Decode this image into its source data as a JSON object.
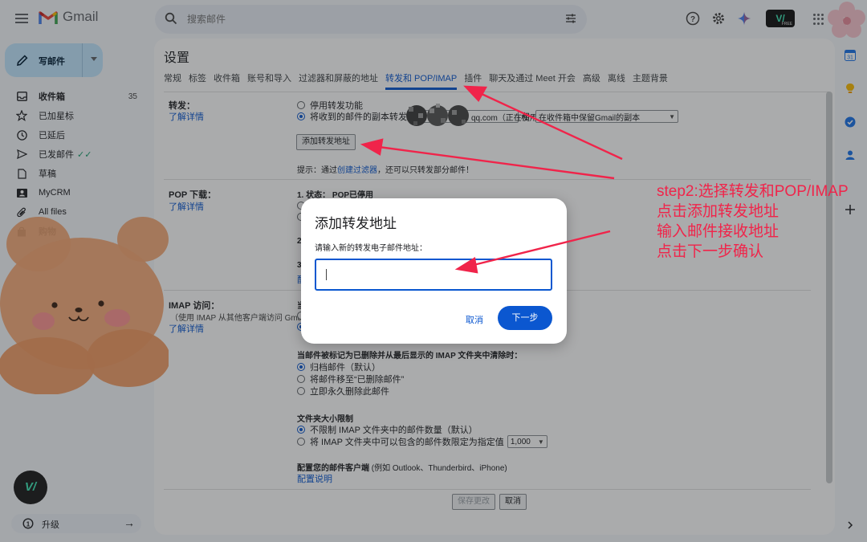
{
  "app": {
    "name": "Gmail"
  },
  "search": {
    "placeholder": "搜索邮件"
  },
  "header": {
    "brand_badge": "V/",
    "brand_badge_sub": "FREE"
  },
  "compose": {
    "label": "写邮件"
  },
  "nav": {
    "items": [
      {
        "label": "收件箱",
        "count": "35",
        "icon": "inbox-icon",
        "bold": true
      },
      {
        "label": "已加星标",
        "icon": "star-icon"
      },
      {
        "label": "已延后",
        "icon": "clock-icon"
      },
      {
        "label": "已发邮件",
        "icon": "send-icon"
      },
      {
        "label": "草稿",
        "icon": "draft-icon"
      },
      {
        "label": "MyCRM",
        "icon": "crm-icon"
      },
      {
        "label": "All files",
        "icon": "attachment-icon"
      },
      {
        "label": "购物",
        "icon": "shopping-icon",
        "bold": true
      }
    ],
    "sent_check": "✓✓"
  },
  "bottom": {
    "badge": "V/",
    "upgrade_label": "升级",
    "upgrade_arrow": "→"
  },
  "settings": {
    "title": "设置",
    "tabs": [
      "常规",
      "标签",
      "收件箱",
      "账号和导入",
      "过滤器和屏蔽的地址",
      "转发和 POP/IMAP",
      "插件",
      "聊天及通过 Meet 开会",
      "高级",
      "离线",
      "主题背景"
    ],
    "active_tab": "转发和 POP/IMAP",
    "forwarding": {
      "label": "转发：",
      "learn_more": "了解详情",
      "option_disable": "停用转发功能",
      "option_forward": "将收到的邮件的副本转发",
      "address_select": "qq.com（正在使用）",
      "and": "和",
      "keep_select": "在收件箱中保留Gmail的副本",
      "add_button": "添加转发地址",
      "hint_prefix": "提示：通过",
      "hint_link": "创建过滤器",
      "hint_suffix": "，还可以只转发部分邮件！"
    },
    "pop": {
      "label": "POP 下载：",
      "learn_more": "了解详情",
      "status": "1. 状态： POP已停用",
      "step2_fragment": "2",
      "step3_fragment": "3",
      "step3_link_fragment": "配"
    },
    "imap": {
      "label": "IMAP 访问：",
      "sub": "（使用 IMAP 从其他客户端访问 Gmail）",
      "learn_more": "了解详情",
      "fragment": "当",
      "delete_heading": "当邮件被标记为已删除并从最后显示的 IMAP 文件夹中清除时：",
      "delete_options": [
        "归档邮件（默认）",
        "将邮件移至“已删除邮件”",
        "立即永久删除此邮件"
      ],
      "folder_heading": "文件夹大小限制",
      "folder_options": [
        "不限制 IMAP 文件夹中的邮件数量（默认）",
        "将 IMAP 文件夹中可以包含的邮件数限定为指定值"
      ],
      "folder_limit_value": "1,000",
      "client_heading": "配置您的邮件客户端",
      "client_hint": "(例如 Outlook、Thunderbird、iPhone)",
      "client_link": "配置说明"
    },
    "save_button": "保存更改",
    "cancel_button": "取消"
  },
  "dialog": {
    "title": "添加转发地址",
    "prompt": "请输入新的转发电子邮件地址：",
    "input_value": "",
    "cancel": "取消",
    "next": "下一步"
  },
  "annotation": {
    "lines": [
      "step2:选择转发和POP/IMAP",
      "点击添加转发地址",
      "输入邮件接收地址",
      "点击下一步确认"
    ],
    "color": "#f0244a"
  },
  "rail": {
    "calendar_day": "31"
  },
  "colors": {
    "accent": "#0b57d0",
    "compose_bg": "#c2e7ff",
    "annotation": "#f0244a"
  }
}
